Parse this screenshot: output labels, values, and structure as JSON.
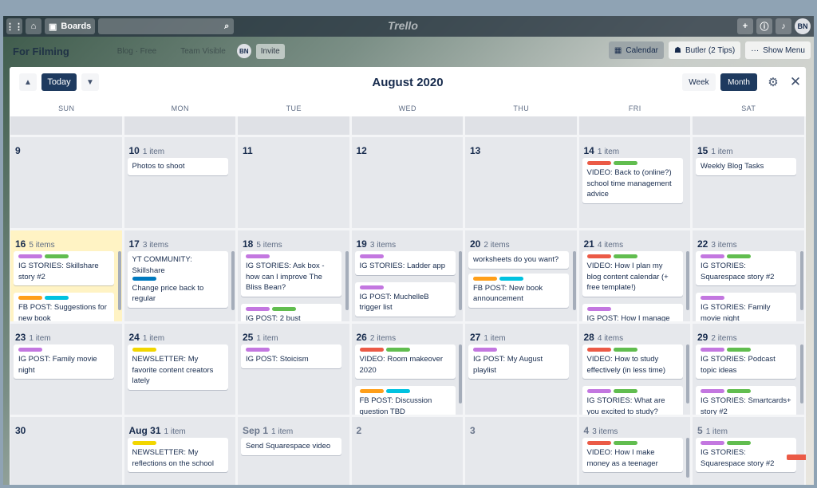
{
  "topbar": {
    "boards_label": "Boards",
    "logo": "Trello",
    "user_initials": "BN"
  },
  "board": {
    "name": "For Filming",
    "faint1": "Blog · Free",
    "faint2": "Team Visible",
    "invite_label": "Invite",
    "member_initials": "BN"
  },
  "board_buttons": {
    "calendar": "Calendar",
    "butler": "Butler (2 Tips)",
    "show_menu": "Show Menu"
  },
  "calendar": {
    "today_label": "Today",
    "title": "August 2020",
    "week_label": "Week",
    "month_label": "Month",
    "weekdays": [
      "SUN",
      "MON",
      "TUE",
      "WED",
      "THU",
      "FRI",
      "SAT"
    ],
    "weeks": [
      [
        {
          "day": "",
          "count": "",
          "cards": []
        },
        {
          "day": "",
          "count": "",
          "cards": []
        },
        {
          "day": "",
          "count": "",
          "cards": []
        },
        {
          "day": "",
          "count": "",
          "cards": []
        },
        {
          "day": "",
          "count": "",
          "cards": []
        },
        {
          "day": "",
          "count": "",
          "cards": []
        },
        {
          "day": "",
          "count": "",
          "cards": []
        }
      ],
      [
        {
          "day": "9",
          "count": "",
          "cards": []
        },
        {
          "day": "10",
          "count": "1 item",
          "cards": [
            {
              "labels": [],
              "text": "Photos to shoot"
            }
          ]
        },
        {
          "day": "11",
          "count": "",
          "cards": []
        },
        {
          "day": "12",
          "count": "",
          "cards": []
        },
        {
          "day": "13",
          "count": "",
          "cards": []
        },
        {
          "day": "14",
          "count": "1 item",
          "cards": [
            {
              "labels": [
                "red",
                "green"
              ],
              "text": "VIDEO: Back to (online?) school time management advice"
            }
          ]
        },
        {
          "day": "15",
          "count": "1 item",
          "cards": [
            {
              "labels": [],
              "text": "Weekly Blog Tasks"
            }
          ]
        }
      ],
      [
        {
          "day": "16",
          "count": "5 items",
          "highlight": true,
          "cards": [
            {
              "labels": [
                "purple",
                "green"
              ],
              "text": "IG STORIES: Skillshare story #2"
            },
            {
              "labels": [
                "orange",
                "sky"
              ],
              "text": "FB POST: Suggestions for new book"
            }
          ]
        },
        {
          "day": "17",
          "count": "3 items",
          "cards": [
            {
              "labels": [],
              "text": "YT COMMUNITY: Skillshare"
            },
            {
              "labels": [
                "blue"
              ],
              "text": "Change price back to regular"
            }
          ]
        },
        {
          "day": "18",
          "count": "5 items",
          "cards": [
            {
              "labels": [
                "purple"
              ],
              "text": "IG STORIES: Ask box - how can I improve The Bliss Bean?"
            },
            {
              "labels": [
                "purple",
                "green"
              ],
              "text": "IG POST: 2 bust"
            }
          ]
        },
        {
          "day": "19",
          "count": "3 items",
          "cards": [
            {
              "labels": [
                "purple"
              ],
              "text": "IG STORIES: Ladder app"
            },
            {
              "labels": [
                "purple"
              ],
              "text": "IG POST: MuchelleB trigger list"
            }
          ]
        },
        {
          "day": "20",
          "count": "2 items",
          "cards": [
            {
              "labels": [],
              "text": "worksheets do you want?"
            },
            {
              "labels": [
                "orange",
                "sky"
              ],
              "text": "FB POST: New book announcement"
            }
          ]
        },
        {
          "day": "21",
          "count": "4 items",
          "cards": [
            {
              "labels": [
                "red",
                "green"
              ],
              "text": "VIDEO: How I plan my blog content calendar (+ free template!)"
            },
            {
              "labels": [
                "purple"
              ],
              "text": "IG POST: How I manage"
            }
          ]
        },
        {
          "day": "22",
          "count": "3 items",
          "cards": [
            {
              "labels": [
                "purple",
                "green"
              ],
              "text": "IG STORIES: Squarespace story #2"
            },
            {
              "labels": [
                "purple"
              ],
              "text": "IG STORIES: Family movie night"
            }
          ]
        }
      ],
      [
        {
          "day": "23",
          "count": "1 item",
          "cards": [
            {
              "labels": [
                "purple"
              ],
              "text": "IG POST: Family movie night"
            }
          ]
        },
        {
          "day": "24",
          "count": "1 item",
          "cards": [
            {
              "labels": [
                "yellow"
              ],
              "text": "NEWSLETTER: My favorite content creators lately"
            }
          ]
        },
        {
          "day": "25",
          "count": "1 item",
          "cards": [
            {
              "labels": [
                "purple"
              ],
              "text": "IG POST: Stoicism"
            }
          ]
        },
        {
          "day": "26",
          "count": "2 items",
          "cards": [
            {
              "labels": [
                "red",
                "green"
              ],
              "text": "VIDEO: Room makeover 2020"
            },
            {
              "labels": [
                "orange",
                "sky"
              ],
              "text": "FB POST: Discussion question TBD"
            }
          ]
        },
        {
          "day": "27",
          "count": "1 item",
          "cards": [
            {
              "labels": [
                "purple"
              ],
              "text": "IG POST: My August playlist"
            }
          ]
        },
        {
          "day": "28",
          "count": "4 items",
          "cards": [
            {
              "labels": [
                "red",
                "green"
              ],
              "text": "VIDEO: How to study effectively (in less time)"
            },
            {
              "labels": [
                "purple",
                "green"
              ],
              "text": "IG STORIES: What are you excited to study?"
            }
          ]
        },
        {
          "day": "29",
          "count": "2 items",
          "cards": [
            {
              "labels": [
                "purple",
                "green"
              ],
              "text": "IG STORIES: Podcast topic ideas"
            },
            {
              "labels": [
                "purple",
                "green"
              ],
              "text": "IG STORIES: Smartcards+ story #2"
            }
          ]
        }
      ],
      [
        {
          "day": "30",
          "count": "",
          "cards": []
        },
        {
          "day": "Aug 31",
          "count": "1 item",
          "cards": [
            {
              "labels": [
                "yellow"
              ],
              "text": "NEWSLETTER: My reflections on the school"
            }
          ]
        },
        {
          "day": "Sep 1",
          "count": "1 item",
          "grey": true,
          "cards": [
            {
              "labels": [],
              "text": "Send Squarespace video"
            }
          ]
        },
        {
          "day": "2",
          "count": "",
          "grey": true,
          "cards": []
        },
        {
          "day": "3",
          "count": "",
          "grey": true,
          "cards": []
        },
        {
          "day": "4",
          "count": "3 items",
          "grey": true,
          "cards": [
            {
              "labels": [
                "red",
                "green"
              ],
              "text": "VIDEO: How I make money as a teenager"
            }
          ]
        },
        {
          "day": "5",
          "count": "1 item",
          "grey": true,
          "cards": [
            {
              "labels": [
                "purple",
                "green"
              ],
              "text": "IG STORIES: Squarespace story #2"
            }
          ]
        }
      ]
    ]
  },
  "label_colors": {
    "purple": "#c377e0",
    "green": "#61bd4f",
    "red": "#eb5a46",
    "orange": "#ff9f1a",
    "sky": "#00c2e0",
    "blue": "#0079bf",
    "yellow": "#f2d600"
  }
}
